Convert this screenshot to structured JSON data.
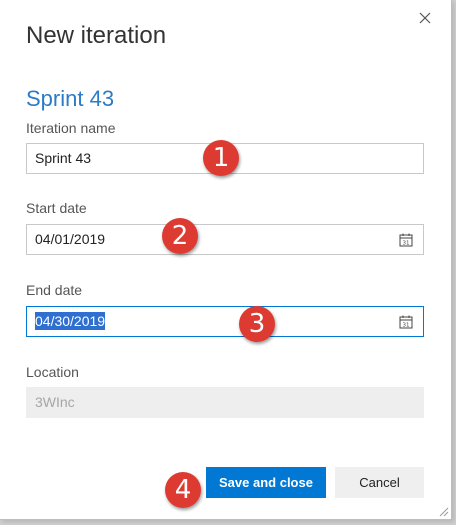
{
  "dialog": {
    "title": "New iteration",
    "close_icon": "close-icon"
  },
  "iteration": {
    "heading": "Sprint 43"
  },
  "fields": {
    "iteration_name": {
      "label": "Iteration name",
      "value": "Sprint 43"
    },
    "start_date": {
      "label": "Start date",
      "value": "04/01/2019",
      "icon": "calendar-icon"
    },
    "end_date": {
      "label": "End date",
      "value": "04/30/2019",
      "icon": "calendar-icon"
    },
    "location": {
      "label": "Location",
      "value": "3WInc"
    }
  },
  "buttons": {
    "save_label": "Save and close",
    "cancel_label": "Cancel"
  },
  "annotations": [
    "1",
    "2",
    "3",
    "4"
  ],
  "colors": {
    "accent": "#0078d4",
    "heading": "#2b7bc7",
    "badge": "#dd3b32"
  }
}
